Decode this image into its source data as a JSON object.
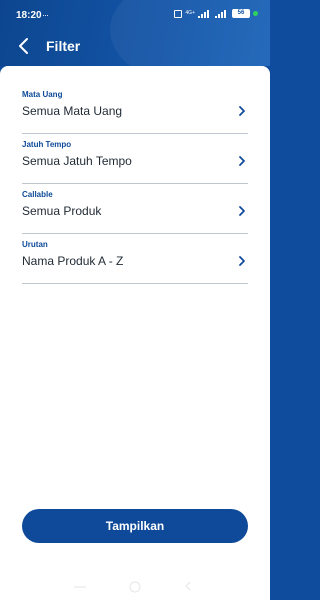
{
  "status_bar": {
    "time": "18:20",
    "notifications": "···",
    "network_label": "4G+",
    "battery": "56"
  },
  "header": {
    "title": "Filter"
  },
  "filters": [
    {
      "label": "Mata Uang",
      "value": "Semua Mata Uang"
    },
    {
      "label": "Jatuh Tempo",
      "value": "Semua Jatuh Tempo"
    },
    {
      "label": "Callable",
      "value": "Semua Produk"
    },
    {
      "label": "Urutan",
      "value": "Nama Produk A - Z"
    }
  ],
  "actions": {
    "apply_label": "Tampilkan"
  },
  "colors": {
    "primary": "#0e4a99",
    "header": "#1355a8",
    "divider": "#bfc6cf",
    "text": "#1f2933"
  },
  "icons": [
    "back-arrow-icon",
    "chevron-right-icon"
  ]
}
